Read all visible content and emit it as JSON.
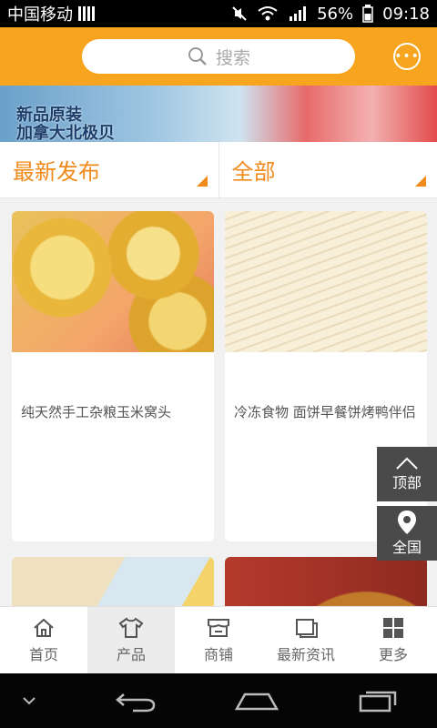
{
  "statusbar": {
    "carrier": "中国移动",
    "battery": "56%",
    "time": "09:18"
  },
  "header": {
    "search_placeholder": "搜索"
  },
  "banner": {
    "line1": "新品原装",
    "line2": "加拿大北极贝"
  },
  "filters": {
    "sort_label": "最新发布",
    "category_label": "全部"
  },
  "products": [
    {
      "title": "纯天然手工杂粮玉米窝头"
    },
    {
      "title": "冷冻食物 面饼早餐饼烤鸭伴侣"
    }
  ],
  "side_buttons": {
    "top_label": "顶部",
    "region_label": "全国"
  },
  "tabs": [
    {
      "label": "首页",
      "icon": "home-icon"
    },
    {
      "label": "产品",
      "icon": "shirt-icon"
    },
    {
      "label": "商铺",
      "icon": "shop-icon"
    },
    {
      "label": "最新资讯",
      "icon": "news-icon"
    },
    {
      "label": "更多",
      "icon": "grid-icon"
    }
  ],
  "colors": {
    "accent": "#f7a51e",
    "filter_text": "#f08a1b"
  }
}
